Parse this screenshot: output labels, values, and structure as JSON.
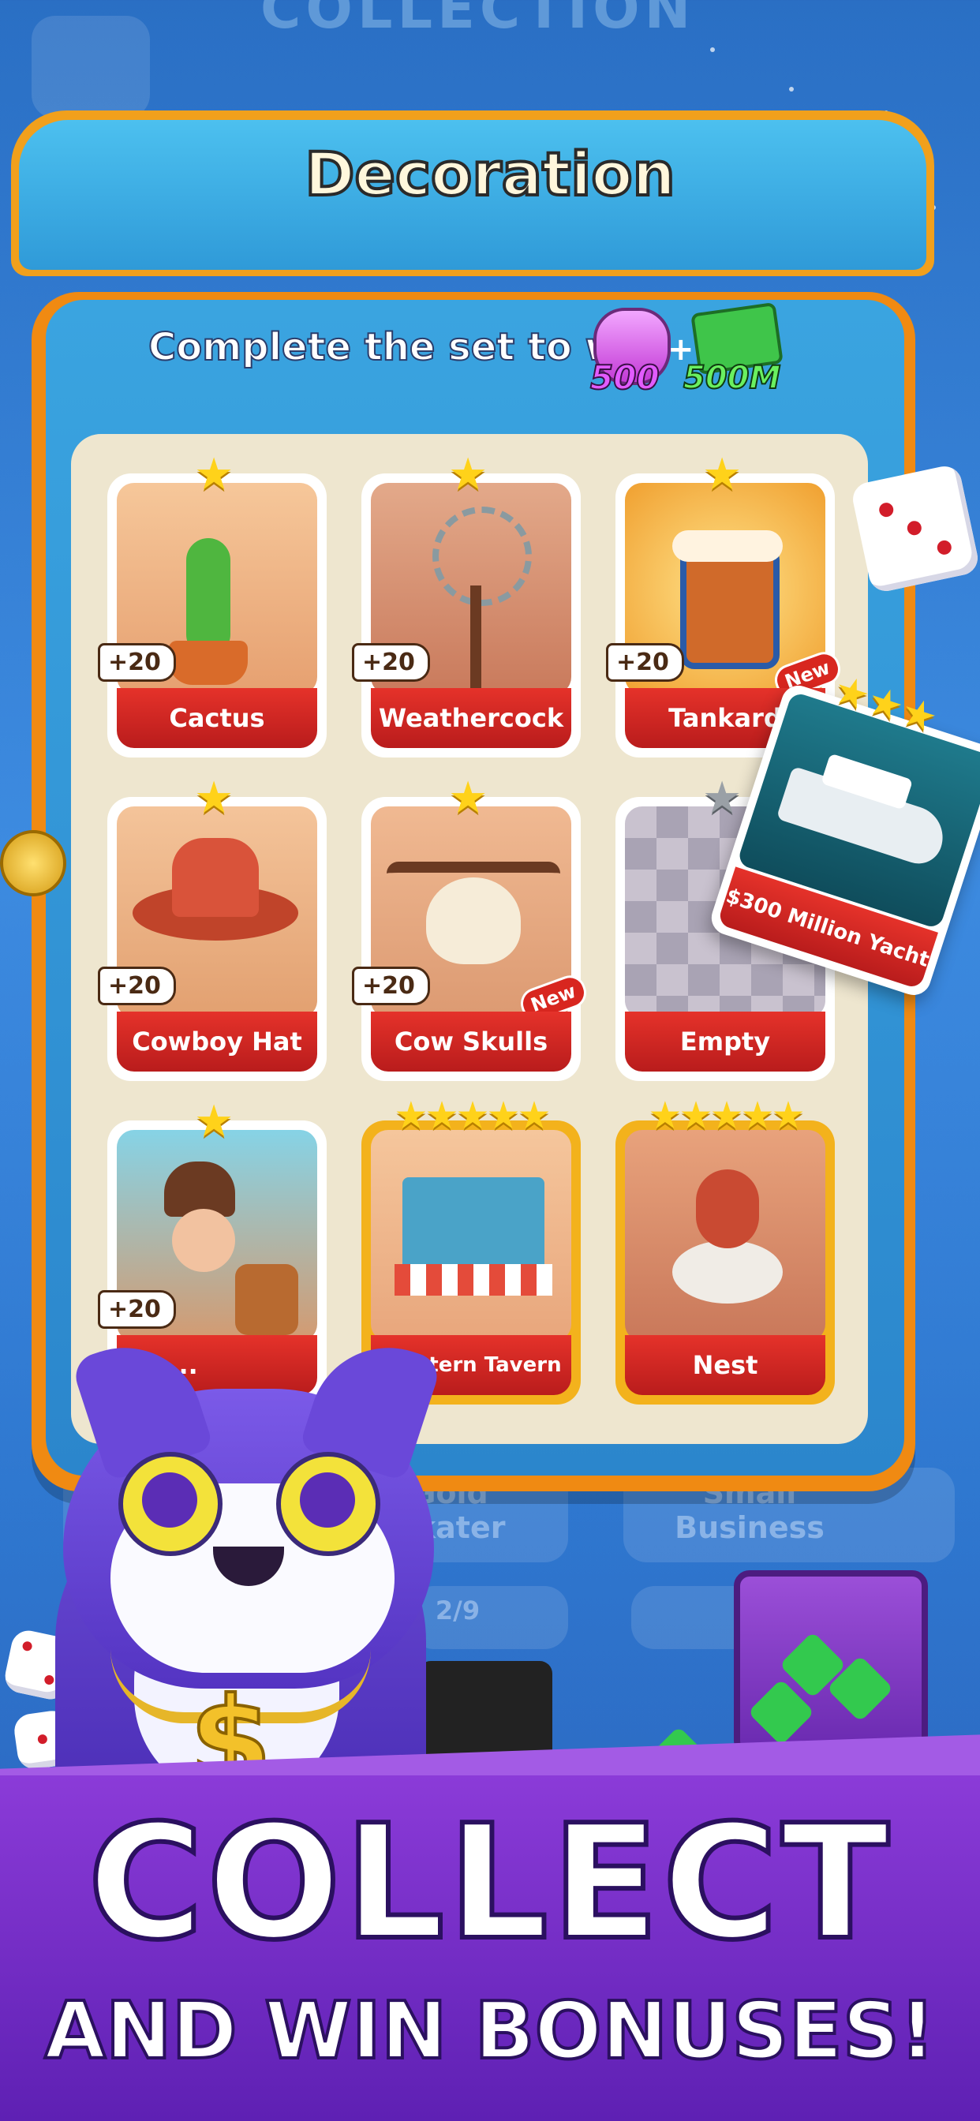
{
  "background": {
    "title": "COLLECTION"
  },
  "panel": {
    "title": "Decoration",
    "subtitle": "Complete the set to win",
    "rewards": [
      {
        "icon": "potion-icon",
        "amount": "500"
      },
      {
        "icon": "cash-icon",
        "amount": "500M"
      }
    ],
    "plus_sign": "+"
  },
  "cards": [
    {
      "name": "Cactus",
      "bonus": "+20",
      "stars": 1,
      "state": "owned"
    },
    {
      "name": "Weathercock",
      "bonus": "+20",
      "stars": 1,
      "state": "owned"
    },
    {
      "name": "Tankard",
      "bonus": "+20",
      "stars": 1,
      "state": "owned",
      "badge": "New"
    },
    {
      "name": "Cowboy Hat",
      "bonus": "+20",
      "stars": 1,
      "state": "owned"
    },
    {
      "name": "Cow Skulls",
      "bonus": "+20",
      "stars": 1,
      "state": "owned",
      "badge": "New"
    },
    {
      "name": "Empty",
      "bonus": "",
      "stars": 1,
      "state": "empty"
    },
    {
      "name": "Re...",
      "bonus": "+20",
      "stars": 1,
      "state": "owned"
    },
    {
      "name": "Western Tavern",
      "bonus": "",
      "stars": 5,
      "state": "gold"
    },
    {
      "name": "Nest",
      "bonus": "",
      "stars": 5,
      "state": "gold"
    }
  ],
  "floating_card": {
    "name": "$300 Million Yacht",
    "stars": 3
  },
  "lower_sets": [
    {
      "name": "Gold Skater"
    },
    {
      "name": "Small Business"
    }
  ],
  "lower_progress": {
    "text": "2/9"
  },
  "promo": {
    "headline": "COLLECT",
    "subline": "AND WIN BONUSES!"
  },
  "colors": {
    "panel_orange": "#f08a12",
    "panel_blue": "#2f9ad8",
    "card_label_red": "#d0241f",
    "star_gold": "#ffd21a",
    "promo_purple": "#7a30cc"
  }
}
